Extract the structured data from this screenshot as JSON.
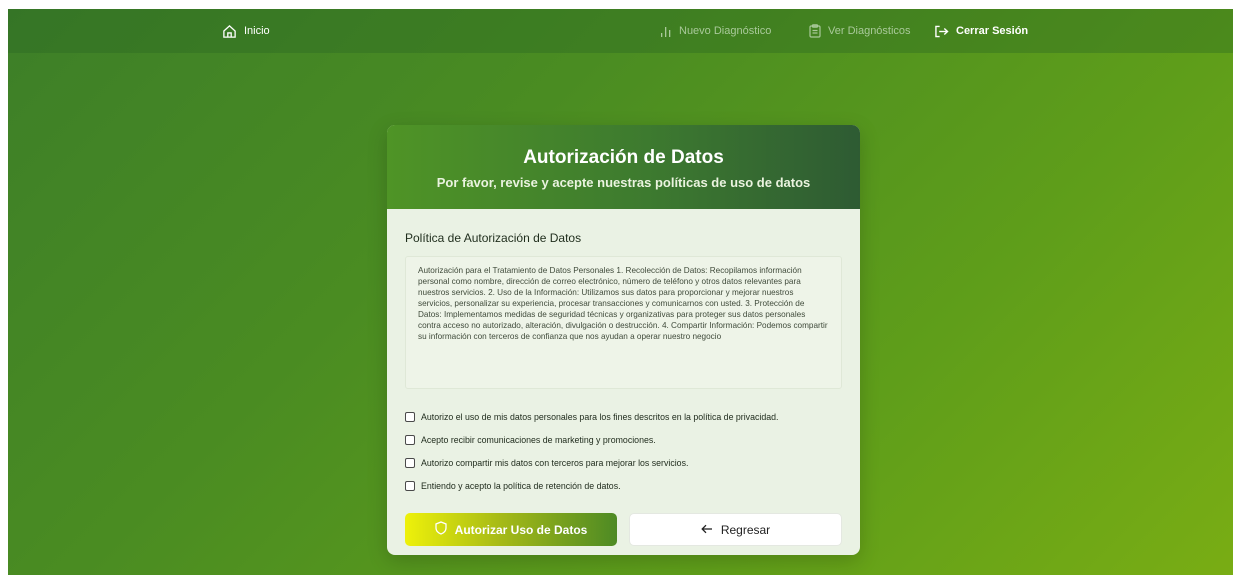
{
  "nav": {
    "home_label": "Inicio",
    "new_label": "Nuevo Diagnóstico",
    "view_label": "Ver Diagnósticos",
    "logout_label": "Cerrar Sesión",
    "active_color": "#ffffff",
    "inactive_color": "#a9c99a"
  },
  "card": {
    "title": "Autorización de Datos",
    "subtitle": "Por favor, revise y acepte nuestras políticas de uso de datos",
    "policy_heading": "Política de Autorización de Datos",
    "policy_text": "Autorización para el Tratamiento de Datos Personales 1. Recolección de Datos: Recopilamos información personal como nombre, dirección de correo electrónico, número de teléfono y otros datos relevantes para nuestros servicios. 2. Uso de la Información: Utilizamos sus datos para proporcionar y mejorar nuestros servicios, personalizar su experiencia, procesar transacciones y comunicarnos con usted. 3. Protección de Datos: Implementamos medidas de seguridad técnicas y organizativas para proteger sus datos personales contra acceso no autorizado, alteración, divulgación o destrucción. 4. Compartir Información: Podemos compartir su información con terceros de confianza que nos ayudan a operar nuestro negocio",
    "checkboxes": [
      {
        "label": "Autorizo el uso de mis datos personales para los fines descritos en la política de privacidad.",
        "checked": false
      },
      {
        "label": "Acepto recibir comunicaciones de marketing y promociones.",
        "checked": false
      },
      {
        "label": "Autorizo compartir mis datos con terceros para mejorar los servicios.",
        "checked": false
      },
      {
        "label": "Entiendo y acepto la política de retención de datos.",
        "checked": false
      }
    ],
    "authorize_label": "Autorizar Uso de Datos",
    "back_label": "Regresar"
  },
  "colors": {
    "background_start": "#3d7f28",
    "background_end": "#79ad14",
    "header_start": "#4f9426",
    "header_end": "#2e5b33",
    "card_bg": "#eaf2e4",
    "authorize_gradient_start": "#eef10a",
    "authorize_gradient_end": "#4d8a24"
  },
  "icons": {
    "home": "home-icon",
    "chart": "bar-chart-icon",
    "clipboard": "clipboard-icon",
    "logout": "logout-icon",
    "shield": "shield-icon",
    "back": "arrow-left-icon"
  }
}
